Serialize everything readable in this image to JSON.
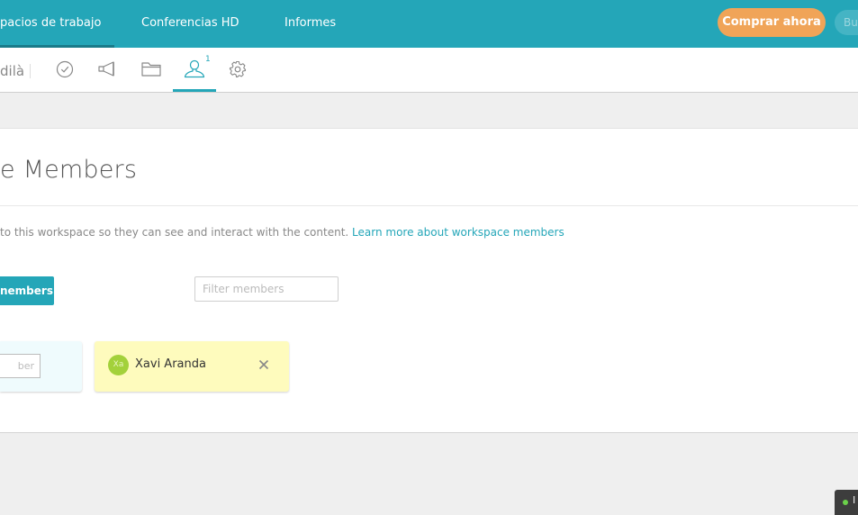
{
  "topbar": {
    "nav": [
      "pacios de trabajo",
      "Conferencias HD",
      "Informes"
    ],
    "buy_label": "Comprar ahora",
    "search_label": "Bu",
    "accent": "#24a6b8"
  },
  "subbar": {
    "workspace_name": "dilà",
    "tools": [
      "check-circle-icon",
      "megaphone-icon",
      "folder-icon",
      "person-icon",
      "gear-icon"
    ],
    "members_badge": "1"
  },
  "main": {
    "title": "e Members",
    "description": "to this workspace so they can see and interact with the content.",
    "learn_more": "Learn more about workspace members",
    "add_button": "nembers",
    "filter_placeholder": "Filter members",
    "new_member_placeholder": "ber",
    "members": [
      {
        "initials": "Xa",
        "name": "Xavi Aranda"
      }
    ]
  },
  "chat": {
    "label": "I"
  }
}
